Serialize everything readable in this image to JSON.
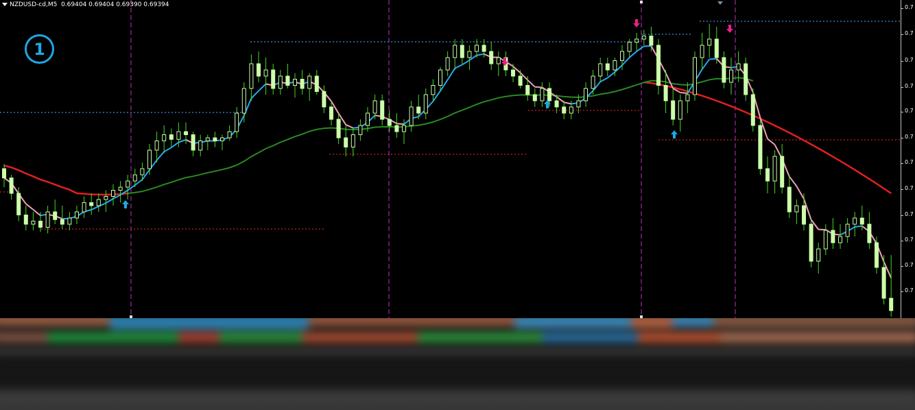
{
  "header": {
    "symbol": "NZDUSD-cd,M5",
    "prices": "0.69404 0.69404 0.69390 0.69394"
  },
  "badge": {
    "label": "1"
  },
  "y_axis": {
    "labels": [
      "0.7",
      "0.7",
      "0.7",
      "0.7",
      "0.7",
      "0.7",
      "0.7",
      "0.7",
      "0.7",
      "0.7",
      "0.7",
      "0.7"
    ]
  },
  "colors": {
    "background": "#000000",
    "candle": "#ccffaa",
    "wick": "#44dd22",
    "fast_ma_up": "#29a8f0",
    "fast_ma_down": "#f0a0b8",
    "slow_green_ma": "#2a8a1f",
    "red_ma": "#e02020",
    "buy_arrow": "#1fa7e6",
    "sell_arrow": "#e8208a",
    "level_blue": "#3a8fd8",
    "level_red": "#c82020",
    "separator": "#c030c0"
  },
  "icons": [
    "buy-arrow-icon",
    "sell-arrow-icon",
    "dropdown-triangle-icon"
  ],
  "chart_data": {
    "type": "candlestick",
    "symbol": "NZDUSD-cd",
    "timeframe": "M5",
    "price_note": "values in chart y units (0 = bottom of plot, 100 = top)",
    "ylim": [
      0,
      100
    ],
    "candles_ohlc": [
      [
        48.0,
        49.5,
        42.0,
        45.0
      ],
      [
        45.0,
        46.0,
        38.0,
        40.0
      ],
      [
        40.0,
        42.0,
        31.0,
        33.0
      ],
      [
        33.0,
        36.0,
        28.0,
        30.0
      ],
      [
        30.0,
        34.0,
        28.0,
        31.0
      ],
      [
        31.0,
        34.0,
        27.5,
        29.0
      ],
      [
        29.0,
        36.0,
        27.0,
        34.0
      ],
      [
        34.0,
        38.0,
        30.0,
        31.5
      ],
      [
        31.5,
        36.0,
        28.5,
        30.0
      ],
      [
        30.0,
        34.0,
        28.0,
        32.0
      ],
      [
        32.0,
        36.0,
        30.0,
        34.0
      ],
      [
        34.0,
        39.0,
        32.0,
        37.0
      ],
      [
        37.0,
        40.0,
        33.0,
        36.0
      ],
      [
        36.0,
        40.0,
        34.0,
        38.0
      ],
      [
        38.0,
        41.0,
        34.0,
        39.0
      ],
      [
        39.0,
        43.0,
        36.0,
        41.0
      ],
      [
        41.0,
        44.0,
        37.0,
        42.0
      ],
      [
        42.0,
        46.0,
        38.0,
        44.0
      ],
      [
        44.0,
        48.0,
        42.0,
        46.0
      ],
      [
        46.0,
        50.0,
        44.0,
        48.0
      ],
      [
        48.0,
        56.0,
        46.0,
        54.0
      ],
      [
        54.0,
        60.0,
        50.0,
        57.0
      ],
      [
        57.0,
        62.0,
        53.0,
        59.0
      ],
      [
        59.0,
        61.0,
        55.0,
        57.5
      ],
      [
        57.5,
        63.0,
        55.0,
        60.0
      ],
      [
        60.0,
        63.0,
        56.0,
        59.0
      ],
      [
        59.0,
        60.0,
        52.0,
        54.0
      ],
      [
        54.0,
        59.0,
        52.0,
        57.0
      ],
      [
        57.0,
        59.0,
        54.0,
        58.0
      ],
      [
        58.0,
        60.0,
        55.0,
        57.0
      ],
      [
        57.0,
        59.0,
        54.0,
        58.0
      ],
      [
        58.0,
        62.0,
        57.0,
        60.0
      ],
      [
        60.0,
        68.0,
        58.0,
        66.0
      ],
      [
        66.0,
        76.0,
        63.0,
        74.0
      ],
      [
        74.0,
        85.0,
        70.0,
        82.0
      ],
      [
        82.0,
        86.0,
        76.0,
        78.0
      ],
      [
        78.0,
        84.0,
        72.0,
        80.0
      ],
      [
        80.0,
        82.0,
        72.0,
        74.0
      ],
      [
        74.0,
        80.0,
        72.0,
        78.0
      ],
      [
        78.0,
        82.0,
        74.0,
        75.0
      ],
      [
        75.0,
        79.0,
        71.0,
        77.0
      ],
      [
        77.0,
        80.0,
        72.0,
        74.0
      ],
      [
        74.0,
        79.0,
        70.0,
        78.0
      ],
      [
        78.0,
        80.0,
        72.0,
        73.0
      ],
      [
        73.0,
        75.0,
        66.0,
        68.0
      ],
      [
        68.0,
        70.0,
        62.0,
        64.0
      ],
      [
        64.0,
        66.0,
        56.0,
        58.0
      ],
      [
        58.0,
        62.0,
        52.0,
        55.0
      ],
      [
        55.0,
        61.0,
        52.0,
        59.0
      ],
      [
        59.0,
        64.0,
        57.0,
        62.0
      ],
      [
        62.0,
        68.0,
        60.0,
        66.0
      ],
      [
        66.0,
        72.0,
        64.0,
        70.0
      ],
      [
        70.0,
        72.0,
        62.0,
        64.0
      ],
      [
        64.0,
        67.0,
        60.0,
        62.0
      ],
      [
        62.0,
        66.0,
        58.0,
        60.0
      ],
      [
        60.0,
        64.0,
        56.0,
        62.0
      ],
      [
        62.0,
        70.0,
        60.0,
        68.0
      ],
      [
        68.0,
        72.0,
        64.0,
        66.0
      ],
      [
        66.0,
        74.0,
        64.0,
        72.0
      ],
      [
        72.0,
        77.0,
        70.0,
        75.0
      ],
      [
        75.0,
        81.0,
        73.0,
        80.0
      ],
      [
        80.0,
        86.0,
        78.0,
        84.0
      ],
      [
        84.0,
        90.0,
        80.0,
        88.0
      ],
      [
        88.0,
        90.0,
        82.0,
        84.0
      ],
      [
        84.0,
        88.0,
        80.0,
        86.0
      ],
      [
        86.0,
        90.0,
        84.0,
        88.0
      ],
      [
        88.0,
        90.0,
        84.0,
        86.0
      ],
      [
        86.0,
        89.0,
        80.0,
        82.0
      ],
      [
        82.0,
        86.0,
        78.0,
        84.0
      ],
      [
        84.0,
        86.0,
        78.0,
        80.0
      ],
      [
        80.0,
        82.0,
        76.0,
        78.0
      ],
      [
        78.0,
        80.0,
        74.0,
        75.0
      ],
      [
        75.0,
        78.0,
        70.0,
        72.0
      ],
      [
        72.0,
        74.0,
        68.0,
        70.0
      ],
      [
        70.0,
        76.0,
        68.0,
        74.0
      ],
      [
        74.0,
        76.0,
        68.0,
        70.0
      ],
      [
        70.0,
        72.0,
        66.0,
        68.0
      ],
      [
        68.0,
        70.0,
        64.0,
        66.0
      ],
      [
        66.0,
        70.0,
        64.0,
        68.0
      ],
      [
        68.0,
        72.0,
        66.0,
        70.0
      ],
      [
        70.0,
        76.0,
        68.0,
        74.0
      ],
      [
        74.0,
        80.0,
        72.0,
        78.0
      ],
      [
        78.0,
        84.0,
        76.0,
        82.0
      ],
      [
        82.0,
        84.0,
        78.0,
        80.0
      ],
      [
        80.0,
        84.0,
        78.0,
        83.0
      ],
      [
        83.0,
        88.0,
        80.0,
        86.0
      ],
      [
        86.0,
        90.0,
        84.0,
        89.0
      ],
      [
        89.0,
        92.0,
        86.0,
        90.0
      ],
      [
        90.0,
        93.0,
        88.0,
        91.0
      ],
      [
        91.0,
        94.0,
        86.0,
        88.0
      ],
      [
        88.0,
        90.0,
        72.0,
        75.0
      ],
      [
        75.0,
        80.0,
        66.0,
        70.0
      ],
      [
        70.0,
        74.0,
        62.0,
        64.0
      ],
      [
        64.0,
        72.0,
        60.0,
        70.0
      ],
      [
        70.0,
        76.0,
        66.0,
        72.0
      ],
      [
        72.0,
        86.0,
        70.0,
        84.0
      ],
      [
        84.0,
        92.0,
        80.0,
        88.0
      ],
      [
        88.0,
        95.0,
        84.0,
        90.0
      ],
      [
        90.0,
        94.0,
        82.0,
        84.0
      ],
      [
        84.0,
        86.0,
        74.0,
        76.0
      ],
      [
        76.0,
        84.0,
        72.0,
        80.0
      ],
      [
        80.0,
        86.0,
        76.0,
        82.0
      ],
      [
        82.0,
        84.0,
        70.0,
        72.0
      ],
      [
        72.0,
        74.0,
        60.0,
        62.0
      ],
      [
        62.0,
        64.0,
        46.0,
        48.0
      ],
      [
        48.0,
        52.0,
        40.0,
        44.0
      ],
      [
        44.0,
        54.0,
        40.0,
        52.0
      ],
      [
        52.0,
        56.0,
        40.0,
        42.0
      ],
      [
        42.0,
        46.0,
        32.0,
        34.0
      ],
      [
        34.0,
        38.0,
        30.0,
        36.0
      ],
      [
        36.0,
        40.0,
        28.0,
        30.0
      ],
      [
        30.0,
        32.0,
        16.0,
        18.0
      ],
      [
        18.0,
        24.0,
        14.0,
        22.0
      ],
      [
        22.0,
        30.0,
        20.0,
        28.0
      ],
      [
        28.0,
        32.0,
        22.0,
        24.0
      ],
      [
        24.0,
        30.0,
        22.0,
        26.0
      ],
      [
        26.0,
        32.0,
        24.0,
        30.0
      ],
      [
        30.0,
        34.0,
        26.0,
        32.0
      ],
      [
        32.0,
        36.0,
        28.0,
        30.0
      ],
      [
        30.0,
        34.0,
        22.0,
        24.0
      ],
      [
        24.0,
        26.0,
        14.0,
        16.0
      ],
      [
        16.0,
        20.0,
        4.0,
        6.0
      ],
      [
        6.0,
        20.0,
        0.0,
        2.0
      ]
    ],
    "annotations": {
      "buy_arrows": 4,
      "sell_arrows": 4,
      "session_separators": 4
    }
  }
}
